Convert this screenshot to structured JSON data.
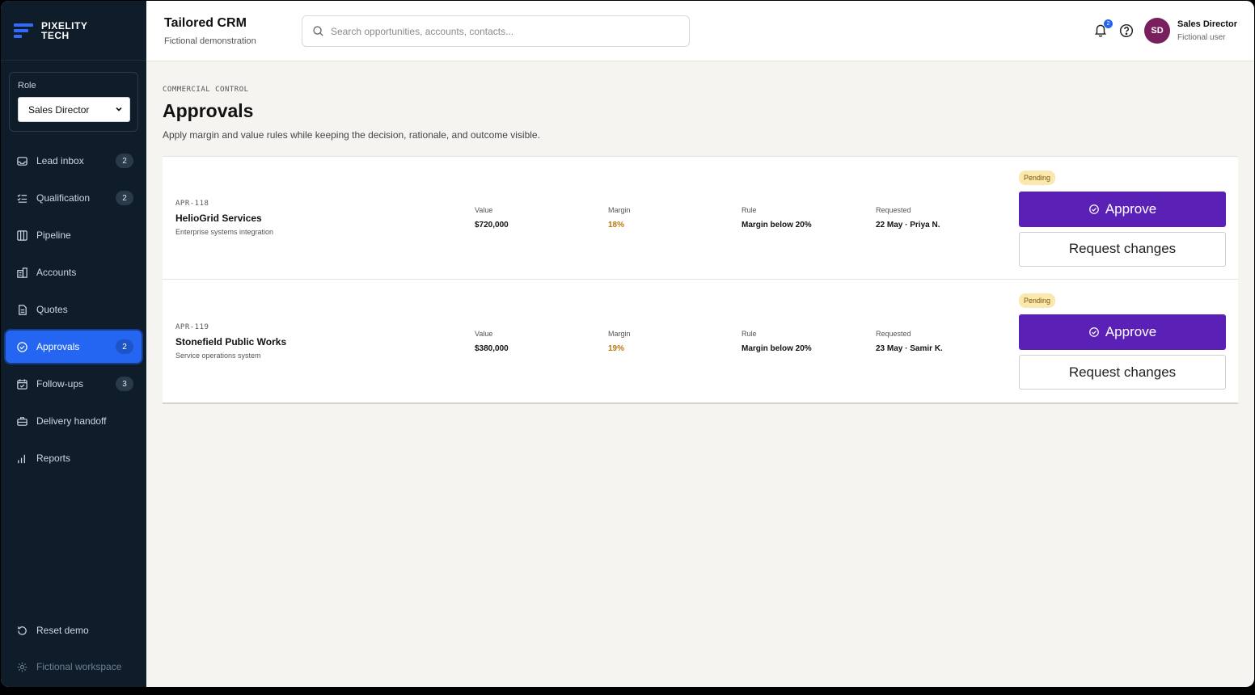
{
  "brand": {
    "line1": "PIXELITY",
    "line2": "TECH"
  },
  "role": {
    "label": "Role",
    "selected": "Sales Director"
  },
  "nav": [
    {
      "label": "Lead inbox",
      "count": "2",
      "icon": "inbox-icon"
    },
    {
      "label": "Qualification",
      "count": "2",
      "icon": "checklist-icon"
    },
    {
      "label": "Pipeline",
      "count": "",
      "icon": "columns-icon"
    },
    {
      "label": "Accounts",
      "count": "",
      "icon": "building-icon"
    },
    {
      "label": "Quotes",
      "count": "",
      "icon": "document-icon"
    },
    {
      "label": "Approvals",
      "count": "2",
      "icon": "check-circle-icon",
      "active": true
    },
    {
      "label": "Follow-ups",
      "count": "3",
      "icon": "calendar-check-icon"
    },
    {
      "label": "Delivery handoff",
      "count": "",
      "icon": "briefcase-icon"
    },
    {
      "label": "Reports",
      "count": "",
      "icon": "bar-chart-icon"
    }
  ],
  "footer": {
    "reset": "Reset demo",
    "workspace": "Fictional workspace"
  },
  "header": {
    "title": "Tailored CRM",
    "subtitle": "Fictional demonstration",
    "search_placeholder": "Search opportunities, accounts, contacts...",
    "notifications": "2",
    "avatar_initials": "SD",
    "user_name": "Sales Director",
    "user_sub": "Fictional user"
  },
  "page": {
    "eyebrow": "COMMERCIAL CONTROL",
    "title": "Approvals",
    "description": "Apply margin and value rules while keeping the decision, rationale, and outcome visible."
  },
  "labels": {
    "value": "Value",
    "margin": "Margin",
    "rule": "Rule",
    "requested": "Requested",
    "approve": "Approve",
    "request_changes": "Request changes"
  },
  "approvals": [
    {
      "id": "APR-118",
      "account": "HelioGrid Services",
      "project": "Enterprise systems integration",
      "value": "$720,000",
      "margin": "18%",
      "rule": "Margin below 20%",
      "requested": "22 May · Priya N.",
      "status": "Pending"
    },
    {
      "id": "APR-119",
      "account": "Stonefield Public Works",
      "project": "Service operations system",
      "value": "$380,000",
      "margin": "19%",
      "rule": "Margin below 20%",
      "requested": "23 May · Samir K.",
      "status": "Pending"
    }
  ],
  "colors": {
    "sidebar": "#0f1d2b",
    "active_nav": "#2466f2",
    "approve": "#5b21b6",
    "pending_badge": "#fbe8b0",
    "margin_warn": "#b9770e"
  }
}
